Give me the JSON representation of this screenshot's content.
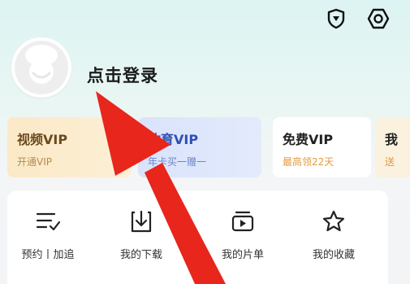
{
  "header": {
    "icons": [
      "shield-icon",
      "settings-icon"
    ]
  },
  "profile": {
    "login_label": "点击登录"
  },
  "vip_cards": [
    {
      "title": "视频VIP",
      "subtitle": "开通VIP"
    },
    {
      "title": "体育VIP",
      "subtitle": "年卡买一赠一"
    },
    {
      "title": "免费VIP",
      "subtitle": "最高领22天"
    },
    {
      "title": "我",
      "subtitle": "送"
    }
  ],
  "quick_actions": [
    {
      "label": "预约丨加追",
      "icon": "checklist-icon"
    },
    {
      "label": "我的下载",
      "icon": "download-icon"
    },
    {
      "label": "我的片单",
      "icon": "playlist-icon"
    },
    {
      "label": "我的收藏",
      "icon": "star-icon"
    }
  ],
  "colors": {
    "annotation_arrow": "#e8261c",
    "video_vip_text": "#6b4a1f",
    "sports_vip_text": "#2e4fb4",
    "free_vip_sub": "#e39a3c"
  }
}
